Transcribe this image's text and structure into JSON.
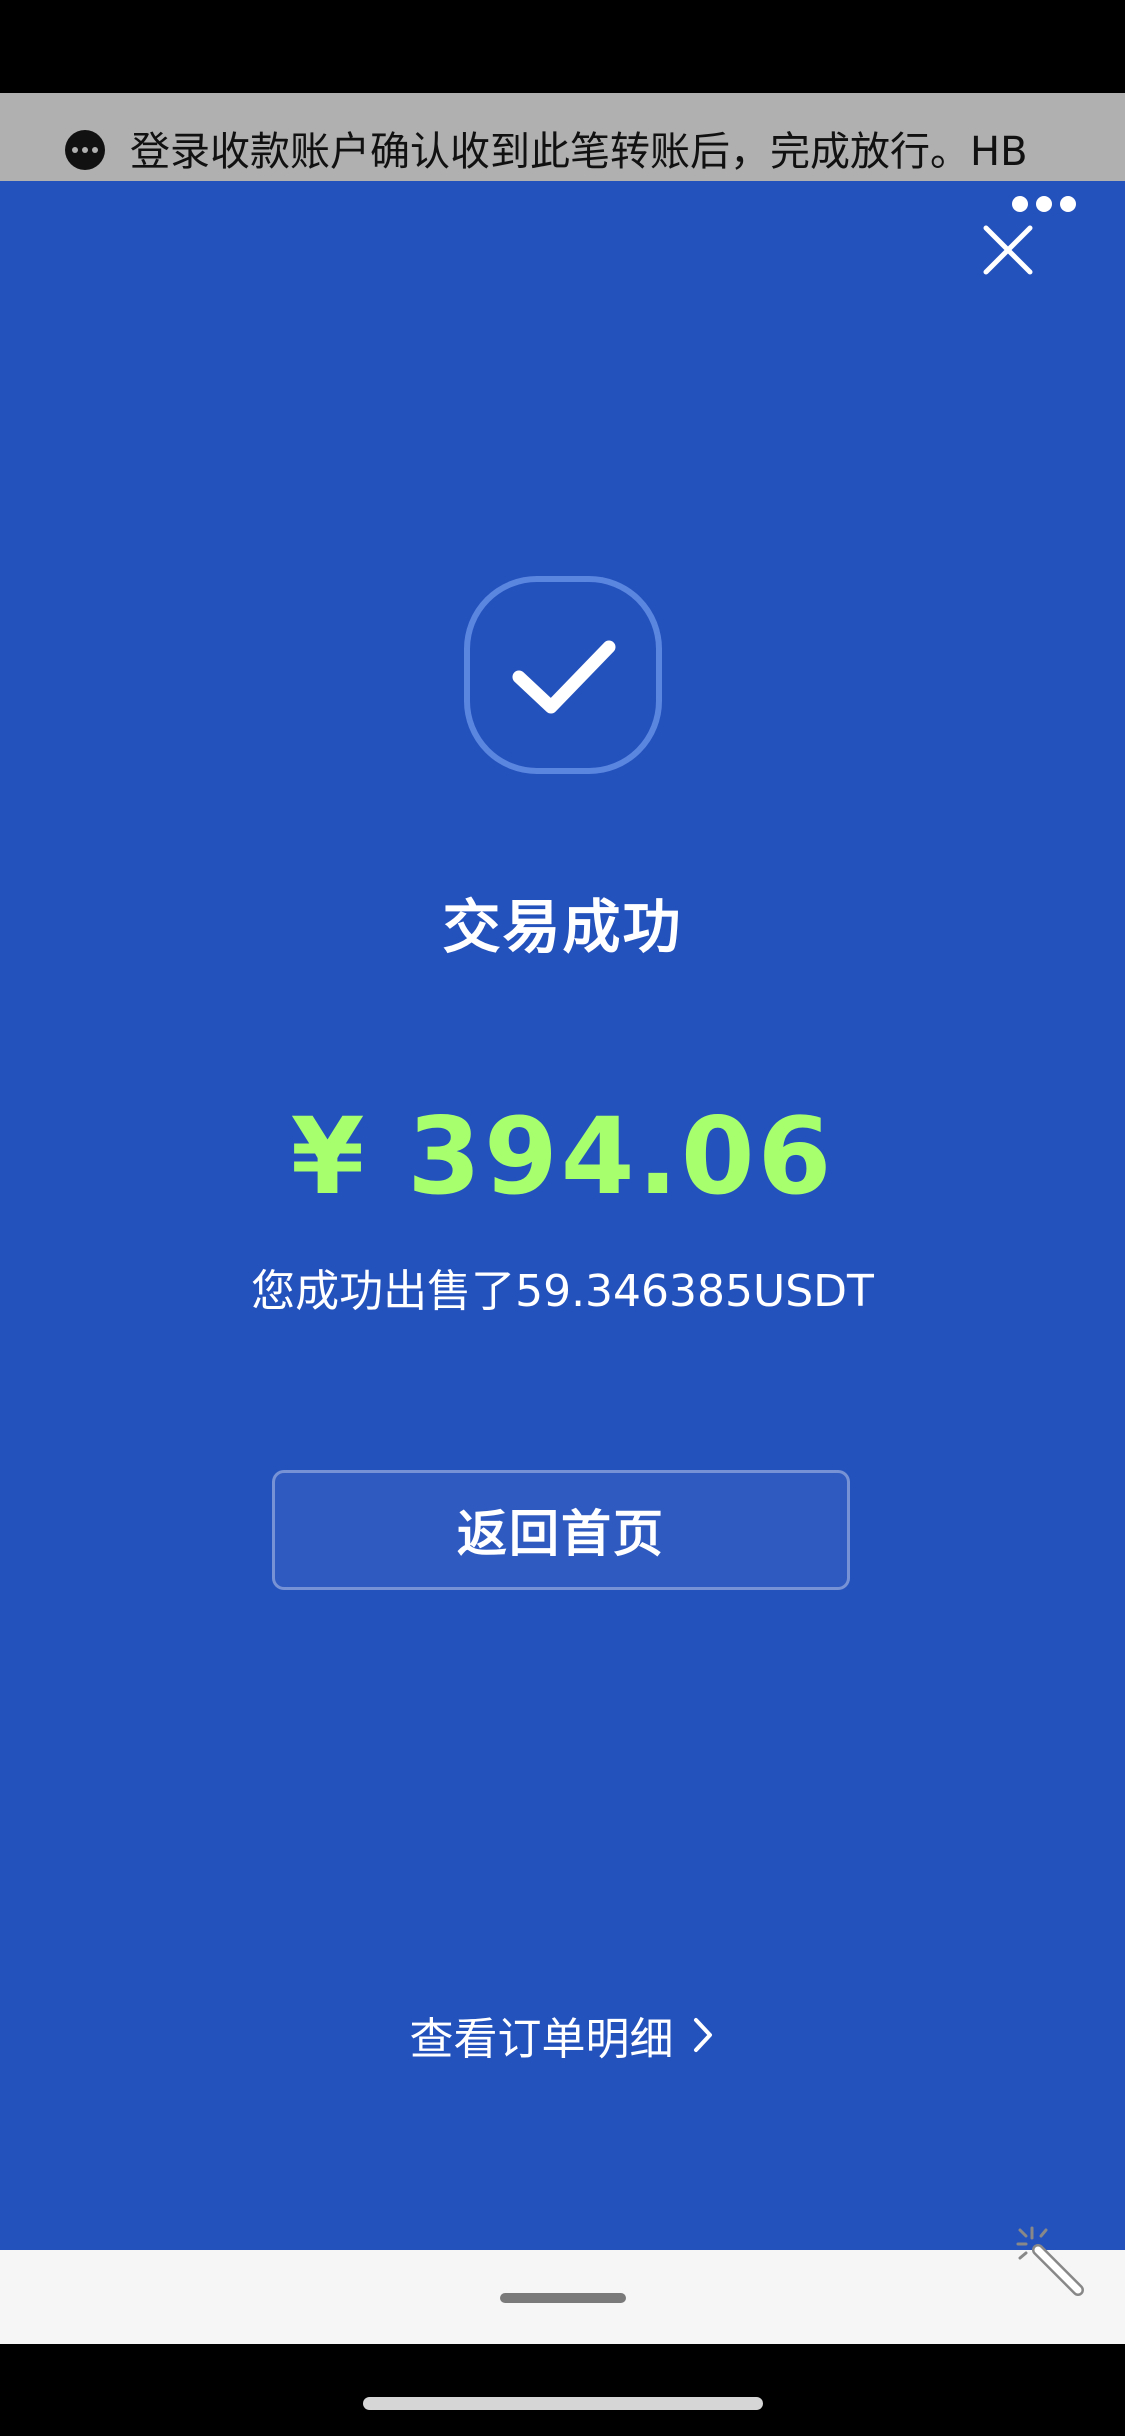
{
  "notice": {
    "text": "登录收款账户确认收到此笔转账后，完成放行。HB",
    "icon": "chat-bubble-icon"
  },
  "header": {
    "more_icon": "more-dots-icon",
    "close_icon": "close-icon"
  },
  "result": {
    "icon": "checkmark-icon",
    "title": "交易成功",
    "amount": "¥ 394.06",
    "description": "您成功出售了59.346385USDT",
    "amount_color": "#a8ff6e"
  },
  "actions": {
    "home_label": "返回首页",
    "details_label": "查看订单明细"
  },
  "colors": {
    "background": "#2452bd",
    "notice_background": "#b0b0b0"
  }
}
